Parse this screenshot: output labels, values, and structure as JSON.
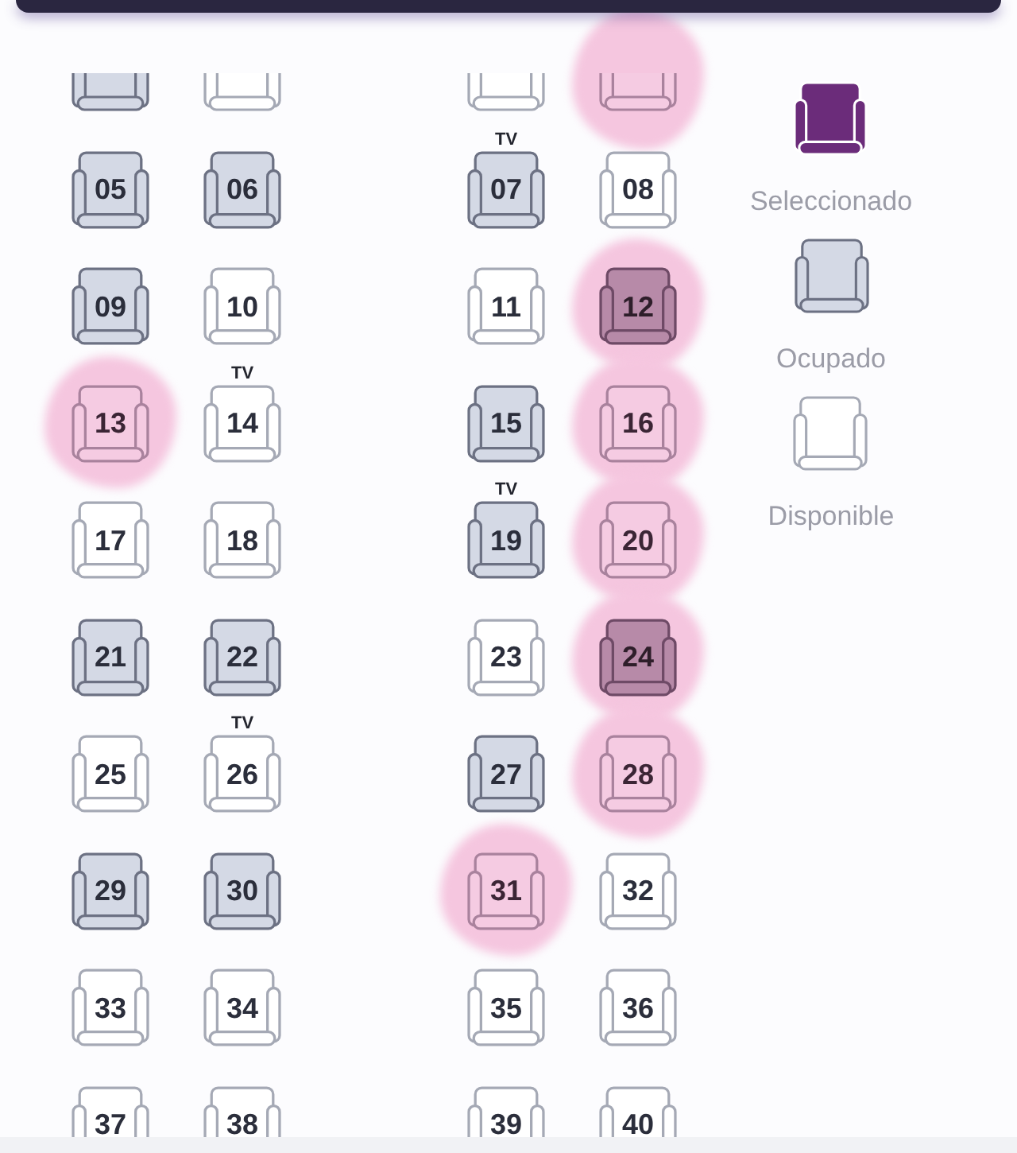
{
  "seat_rows": [
    {
      "clipped_top": true,
      "clipped_bottom": false,
      "seats": [
        {
          "occupied": true,
          "highlighted": false
        },
        {
          "occupied": false,
          "highlighted": false
        },
        {
          "occupied": false,
          "highlighted": false
        },
        {
          "occupied": false,
          "highlighted": true
        }
      ]
    },
    {
      "clipped_top": false,
      "clipped_bottom": false,
      "seats": [
        {
          "number": "05",
          "occupied": true,
          "highlighted": false
        },
        {
          "number": "06",
          "occupied": true,
          "highlighted": false
        },
        {
          "number": "07",
          "occupied": true,
          "highlighted": false,
          "tag": "TV"
        },
        {
          "number": "08",
          "occupied": false,
          "highlighted": false
        }
      ]
    },
    {
      "clipped_top": false,
      "clipped_bottom": false,
      "seats": [
        {
          "number": "09",
          "occupied": true,
          "highlighted": false
        },
        {
          "number": "10",
          "occupied": false,
          "highlighted": false
        },
        {
          "number": "11",
          "occupied": false,
          "highlighted": false
        },
        {
          "number": "12",
          "occupied": true,
          "highlighted": true
        }
      ]
    },
    {
      "clipped_top": false,
      "clipped_bottom": false,
      "seats": [
        {
          "number": "13",
          "occupied": false,
          "highlighted": true
        },
        {
          "number": "14",
          "occupied": false,
          "highlighted": false,
          "tag": "TV"
        },
        {
          "number": "15",
          "occupied": true,
          "highlighted": false
        },
        {
          "number": "16",
          "occupied": false,
          "highlighted": true
        }
      ]
    },
    {
      "clipped_top": false,
      "clipped_bottom": false,
      "seats": [
        {
          "number": "17",
          "occupied": false,
          "highlighted": false
        },
        {
          "number": "18",
          "occupied": false,
          "highlighted": false
        },
        {
          "number": "19",
          "occupied": true,
          "highlighted": false,
          "tag": "TV"
        },
        {
          "number": "20",
          "occupied": false,
          "highlighted": true
        }
      ]
    },
    {
      "clipped_top": false,
      "clipped_bottom": false,
      "seats": [
        {
          "number": "21",
          "occupied": true,
          "highlighted": false
        },
        {
          "number": "22",
          "occupied": true,
          "highlighted": false
        },
        {
          "number": "23",
          "occupied": false,
          "highlighted": false
        },
        {
          "number": "24",
          "occupied": true,
          "highlighted": true
        }
      ]
    },
    {
      "clipped_top": false,
      "clipped_bottom": false,
      "seats": [
        {
          "number": "25",
          "occupied": false,
          "highlighted": false
        },
        {
          "number": "26",
          "occupied": false,
          "highlighted": false,
          "tag": "TV"
        },
        {
          "number": "27",
          "occupied": true,
          "highlighted": false
        },
        {
          "number": "28",
          "occupied": false,
          "highlighted": true
        }
      ]
    },
    {
      "clipped_top": false,
      "clipped_bottom": false,
      "seats": [
        {
          "number": "29",
          "occupied": true,
          "highlighted": false
        },
        {
          "number": "30",
          "occupied": true,
          "highlighted": false
        },
        {
          "number": "31",
          "occupied": false,
          "highlighted": true
        },
        {
          "number": "32",
          "occupied": false,
          "highlighted": false
        }
      ]
    },
    {
      "clipped_top": false,
      "clipped_bottom": false,
      "seats": [
        {
          "number": "33",
          "occupied": false,
          "highlighted": false
        },
        {
          "number": "34",
          "occupied": false,
          "highlighted": false
        },
        {
          "number": "35",
          "occupied": false,
          "highlighted": false
        },
        {
          "number": "36",
          "occupied": false,
          "highlighted": false
        }
      ]
    },
    {
      "clipped_top": false,
      "clipped_bottom": true,
      "seats": [
        {
          "number": "37",
          "occupied": false,
          "highlighted": false
        },
        {
          "number": "38",
          "occupied": false,
          "highlighted": false
        },
        {
          "number": "39",
          "occupied": false,
          "highlighted": false
        },
        {
          "number": "40",
          "occupied": false,
          "highlighted": false
        }
      ]
    }
  ],
  "legend": [
    {
      "kind": "selected",
      "label": "Seleccionado"
    },
    {
      "kind": "occupied",
      "label": "Ocupado"
    },
    {
      "kind": "available",
      "label": "Disponible"
    }
  ]
}
